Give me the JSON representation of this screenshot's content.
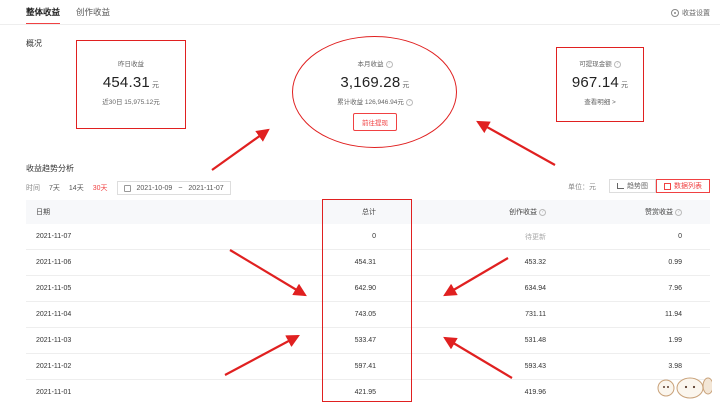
{
  "tabs": [
    {
      "label": "整体收益",
      "active": true
    },
    {
      "label": "创作收益",
      "active": false
    }
  ],
  "settings_label": "收益设置",
  "overview": {
    "title": "概况",
    "yesterday": {
      "label": "昨日收益",
      "value": "454.31",
      "unit": "元",
      "sub": "近30日 15,975.12元"
    },
    "month": {
      "label": "本月收益",
      "value": "3,169.28",
      "unit": "元",
      "sub": "累计收益 126,946.94元",
      "button": "前往提现"
    },
    "withdrawable": {
      "label": "可提现金额",
      "value": "967.14",
      "unit": "元",
      "link": "查看明细 >"
    }
  },
  "trend": {
    "title": "收益趋势分析",
    "time_label": "时间",
    "ranges": [
      {
        "label": "7天",
        "active": false
      },
      {
        "label": "14天",
        "active": false
      },
      {
        "label": "30天",
        "active": true
      }
    ],
    "date_start": "2021-10-09",
    "date_sep": "~",
    "date_end": "2021-11-07",
    "unit_label": "单位：元",
    "view_chart": "趋势图",
    "view_list": "数据列表"
  },
  "table": {
    "headers": {
      "date": "日期",
      "total": "总计",
      "create": "创作收益",
      "praise": "赞赏收益"
    },
    "rows": [
      {
        "date": "2021-11-07",
        "total": "0",
        "create": "待更新",
        "praise": "0"
      },
      {
        "date": "2021-11-06",
        "total": "454.31",
        "create": "453.32",
        "praise": "0.99"
      },
      {
        "date": "2021-11-05",
        "total": "642.90",
        "create": "634.94",
        "praise": "7.96"
      },
      {
        "date": "2021-11-04",
        "total": "743.05",
        "create": "731.11",
        "praise": "11.94"
      },
      {
        "date": "2021-11-03",
        "total": "533.47",
        "create": "531.48",
        "praise": "1.99"
      },
      {
        "date": "2021-11-02",
        "total": "597.41",
        "create": "593.43",
        "praise": "3.98"
      },
      {
        "date": "2021-11-01",
        "total": "421.95",
        "create": "419.96",
        "praise": ""
      }
    ]
  },
  "colors": {
    "accent": "#f04142",
    "annotation": "#e02020"
  }
}
